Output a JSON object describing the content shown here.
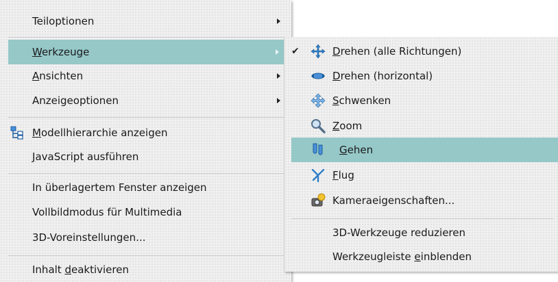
{
  "main_menu": {
    "items": [
      {
        "label": "Teiloptionen",
        "has_submenu": true
      },
      {
        "pre": "",
        "mn": "W",
        "post": "erkzeuge",
        "has_submenu": true,
        "highlighted": true
      },
      {
        "pre": "",
        "mn": "A",
        "post": "nsichten",
        "has_submenu": true
      },
      {
        "label": "Anzeigeoptionen",
        "has_submenu": true
      },
      {
        "pre": "",
        "mn": "M",
        "post": "odellhierarchie anzeigen",
        "icon": "model-tree-icon"
      },
      {
        "pre": "",
        "mn": "J",
        "post": "avaScript ausführen"
      },
      {
        "label": "In überlagertem Fenster anzeigen"
      },
      {
        "label": "Vollbildmodus für Multimedia"
      },
      {
        "label": "3D-Voreinstellungen..."
      },
      {
        "pre": "Inhalt ",
        "mn": "d",
        "post": "eaktivieren"
      }
    ]
  },
  "sub_menu": {
    "items": [
      {
        "pre": "",
        "mn": "D",
        "post": "rehen (alle Richtungen)",
        "icon": "rotate-all-icon",
        "checked": true
      },
      {
        "pre": "",
        "mn": "D",
        "post": "rehen (horizontal)",
        "icon": "rotate-horizontal-icon"
      },
      {
        "pre": "",
        "mn": "S",
        "post": "chwenken",
        "icon": "pan-icon"
      },
      {
        "pre": "",
        "mn": "Z",
        "post": "oom",
        "icon": "zoom-icon"
      },
      {
        "pre": "",
        "mn": "G",
        "post": "ehen",
        "icon": "walk-icon",
        "highlighted": true
      },
      {
        "pre": "",
        "mn": "F",
        "post": "lug",
        "icon": "fly-icon"
      },
      {
        "label": "Kameraeigenschaften...",
        "icon": "camera-properties-icon"
      },
      {
        "label": "3D-Werkzeuge reduzieren"
      },
      {
        "pre": "Werkzeugleiste ",
        "mn": "e",
        "post": "inblenden"
      }
    ]
  },
  "colors": {
    "highlight": "#96c8c8",
    "menu_background": "#f0f0f0"
  }
}
